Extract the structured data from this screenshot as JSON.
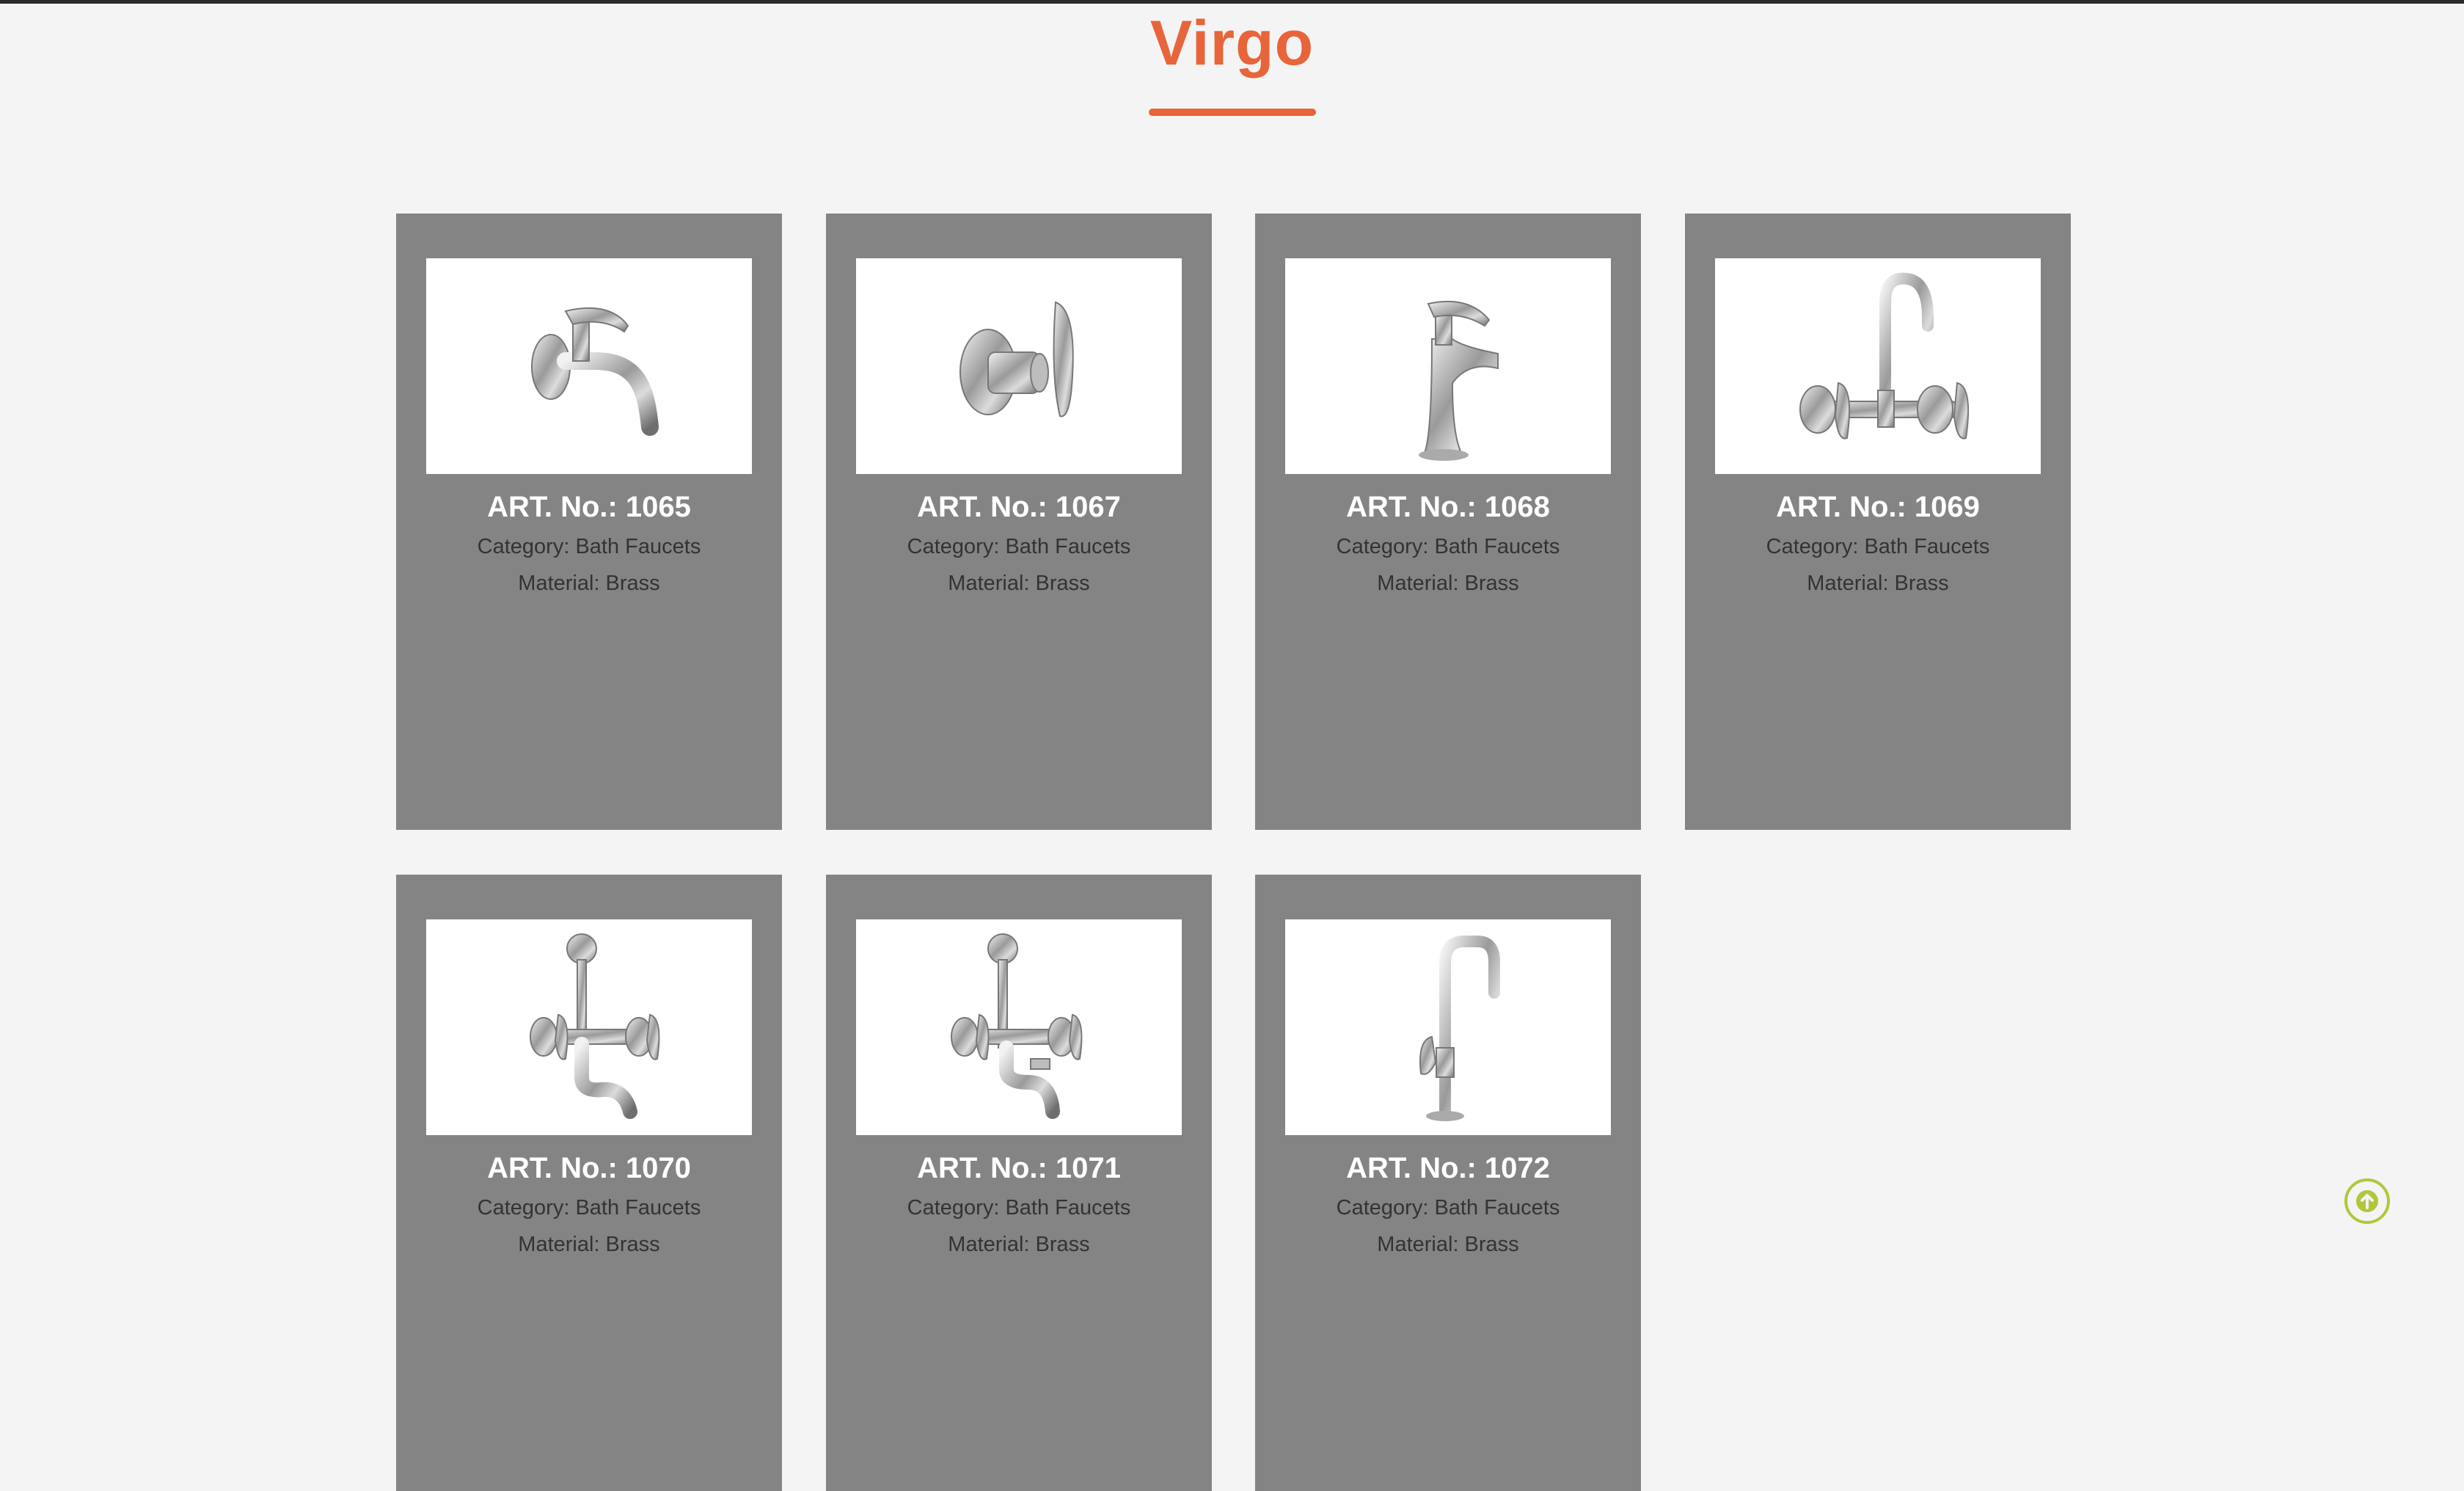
{
  "page": {
    "title": "Virgo",
    "accent_color": "#e8643a",
    "card_color": "#848484"
  },
  "products": [
    {
      "art": "ART. No.: 1065",
      "category": "Category: Bath Faucets",
      "material": "Material: Brass",
      "icon": "bib-cock-faucet-icon"
    },
    {
      "art": "ART. No.: 1067",
      "category": "Category: Bath Faucets",
      "material": "Material: Brass",
      "icon": "angle-valve-faucet-icon"
    },
    {
      "art": "ART. No.: 1068",
      "category": "Category: Bath Faucets",
      "material": "Material: Brass",
      "icon": "pillar-cock-faucet-icon"
    },
    {
      "art": "ART. No.: 1069",
      "category": "Category: Bath Faucets",
      "material": "Material: Brass",
      "icon": "wall-sink-mixer-icon"
    },
    {
      "art": "ART. No.: 1070",
      "category": "Category: Bath Faucets",
      "material": "Material: Brass",
      "icon": "wall-mixer-overhead-icon"
    },
    {
      "art": "ART. No.: 1071",
      "category": "Category: Bath Faucets",
      "material": "Material: Brass",
      "icon": "wall-mixer-crutch-icon"
    },
    {
      "art": "ART. No.: 1072",
      "category": "Category: Bath Faucets",
      "material": "Material: Brass",
      "icon": "sink-cock-swivel-icon"
    }
  ],
  "scroll_top": {
    "icon": "arrow-up-circle-icon",
    "color": "#b3c63b"
  }
}
